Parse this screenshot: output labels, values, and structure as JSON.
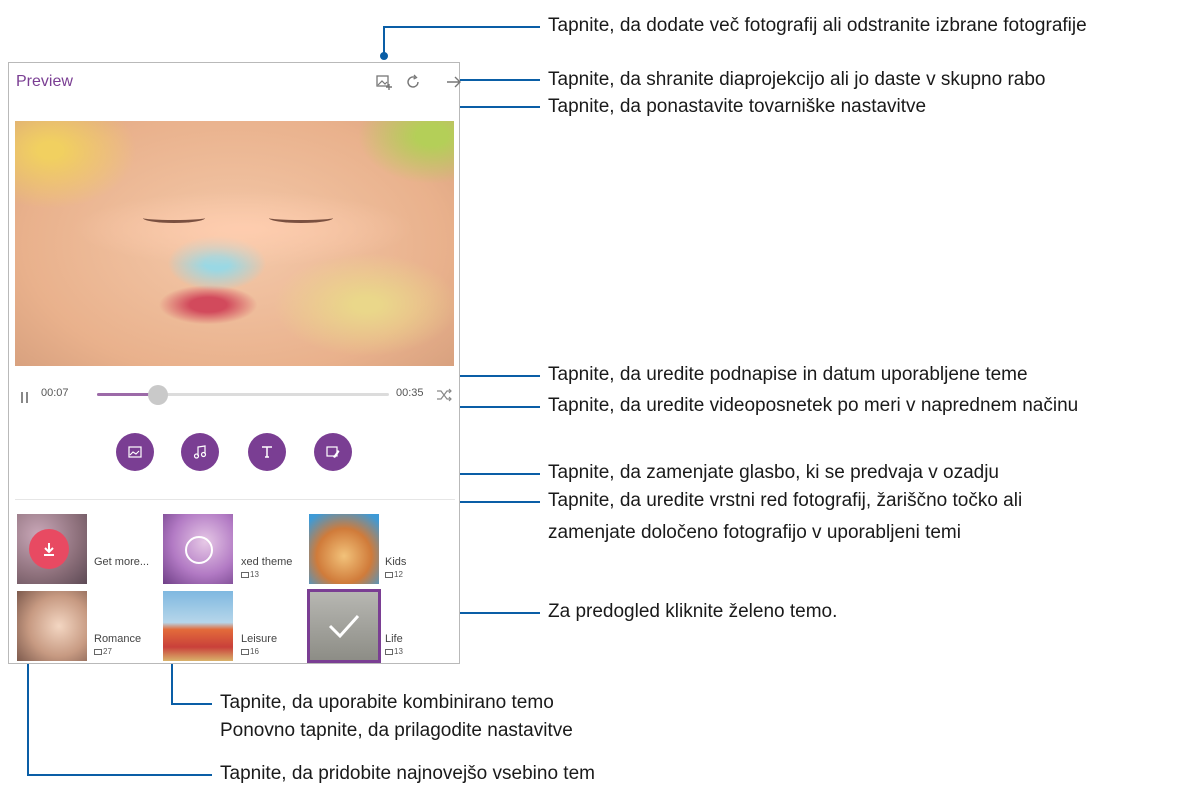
{
  "app": {
    "title": "Preview"
  },
  "toolbar": {
    "icons": [
      "add-photo-icon",
      "reset-icon",
      "next-icon"
    ]
  },
  "player": {
    "elapsed": "00:07",
    "total": "00:35",
    "progress": 0.21
  },
  "actions": {
    "icons": [
      "photo-icon",
      "music-icon",
      "text-icon",
      "video-edit-icon"
    ]
  },
  "themes": [
    {
      "label": "Get more...",
      "count": ""
    },
    {
      "label": "xed theme",
      "count": "13"
    },
    {
      "label": "Kids",
      "count": "12"
    },
    {
      "label": "Romance",
      "count": "27"
    },
    {
      "label": "Leisure",
      "count": "16"
    },
    {
      "label": "Life",
      "count": "13",
      "selected": true
    }
  ],
  "callouts": [
    "Tapnite, da dodate več fotografij ali odstranite izbrane fotografije",
    "Tapnite, da shranite diaprojekcijo ali jo daste v skupno rabo",
    "Tapnite, da ponastavite tovarniške nastavitve",
    "Tapnite, da uredite podnapise in datum uporabljene teme",
    "Tapnite, da uredite videoposnetek po meri v naprednem načinu",
    "Tapnite, da zamenjate glasbo, ki se predvaja v ozadju",
    "Tapnite, da uredite vrstni red fotografij, žariščno točko ali",
    "zamenjate določeno fotografijo v uporabljeni temi",
    "Za predogled kliknite želeno temo.",
    "Tapnite, da uporabite kombinirano temo",
    "Ponovno tapnite, da prilagodite nastavitve",
    "Tapnite, da pridobite najnovejšo vsebino tem"
  ],
  "colors": {
    "accent": "#7a3e93",
    "callout_line": "#0a5ea6",
    "download_badge": "#e84a62"
  }
}
